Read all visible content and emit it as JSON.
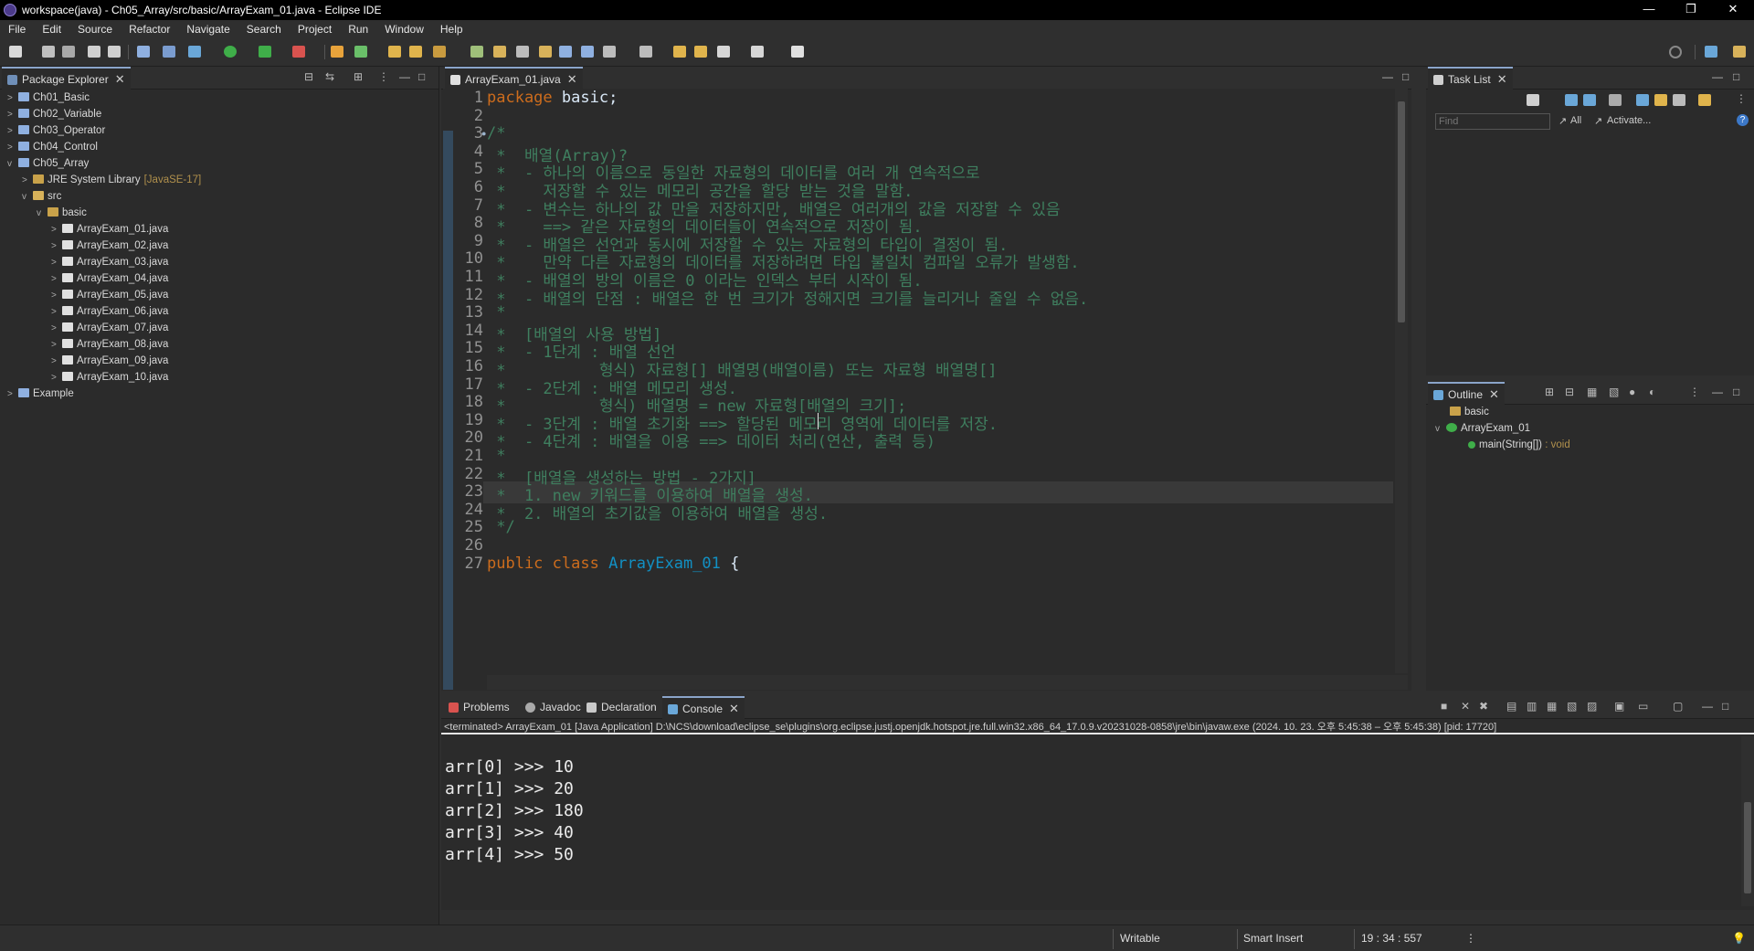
{
  "window": {
    "title": "workspace(java) - Ch05_Array/src/basic/ArrayExam_01.java - Eclipse IDE",
    "controls": [
      "—",
      "❐",
      "✕"
    ]
  },
  "menu": [
    "File",
    "Edit",
    "Source",
    "Refactor",
    "Navigate",
    "Search",
    "Project",
    "Run",
    "Window",
    "Help"
  ],
  "package_explorer": {
    "tab_label": "Package Explorer",
    "items": [
      {
        "label": "Ch01_Basic",
        "twisty": ">",
        "icon": "project-folder-icon"
      },
      {
        "label": "Ch02_Variable",
        "twisty": ">",
        "icon": "project-folder-icon"
      },
      {
        "label": "Ch03_Operator",
        "twisty": ">",
        "icon": "project-folder-icon"
      },
      {
        "label": "Ch04_Control",
        "twisty": ">",
        "icon": "project-folder-icon"
      },
      {
        "label": "Ch05_Array",
        "twisty": "v",
        "icon": "project-folder-icon"
      },
      {
        "label": "JRE System Library",
        "decoration": "[JavaSE-17]",
        "twisty": ">",
        "icon": "library-icon"
      },
      {
        "label": "src",
        "twisty": "v",
        "icon": "source-folder-icon"
      },
      {
        "label": "basic",
        "twisty": "v",
        "icon": "package-icon"
      },
      {
        "label": "ArrayExam_01.java",
        "twisty": ">",
        "icon": "java-file-icon"
      },
      {
        "label": "ArrayExam_02.java",
        "twisty": ">",
        "icon": "java-file-icon"
      },
      {
        "label": "ArrayExam_03.java",
        "twisty": ">",
        "icon": "java-file-icon"
      },
      {
        "label": "ArrayExam_04.java",
        "twisty": ">",
        "icon": "java-file-icon"
      },
      {
        "label": "ArrayExam_05.java",
        "twisty": ">",
        "icon": "java-file-icon"
      },
      {
        "label": "ArrayExam_06.java",
        "twisty": ">",
        "icon": "java-file-icon"
      },
      {
        "label": "ArrayExam_07.java",
        "twisty": ">",
        "icon": "java-file-icon"
      },
      {
        "label": "ArrayExam_08.java",
        "twisty": ">",
        "icon": "java-file-icon"
      },
      {
        "label": "ArrayExam_09.java",
        "twisty": ">",
        "icon": "java-file-icon"
      },
      {
        "label": "ArrayExam_10.java",
        "twisty": ">",
        "icon": "java-file-icon"
      },
      {
        "label": "Example",
        "twisty": ">",
        "icon": "project-folder-icon"
      }
    ]
  },
  "editor": {
    "tab_label": "ArrayExam_01.java",
    "lines": [
      {
        "n": "1",
        "text": "package basic;"
      },
      {
        "n": "2",
        "text": ""
      },
      {
        "n": "3",
        "text": "/*",
        "fold": "●"
      },
      {
        "n": "4",
        "text": " *  배열(Array)?"
      },
      {
        "n": "5",
        "text": " *  - 하나의 이름으로 동일한 자료형의 데이터를 여러 개 연속적으로"
      },
      {
        "n": "6",
        "text": " *    저장할 수 있는 메모리 공간을 할당 받는 것을 말함."
      },
      {
        "n": "7",
        "text": " *  - 변수는 하나의 값 만을 저장하지만, 배열은 여러개의 값을 저장할 수 있음"
      },
      {
        "n": "8",
        "text": " *    ==> 같은 자료형의 데이터들이 연속적으로 저장이 됨."
      },
      {
        "n": "9",
        "text": " *  - 배열은 선언과 동시에 저장할 수 있는 자료형의 타입이 결정이 됨."
      },
      {
        "n": "10",
        "text": " *    만약 다른 자료형의 데이터를 저장하려면 타입 불일치 컴파일 오류가 발생함."
      },
      {
        "n": "11",
        "text": " *  - 배열의 방의 이름은 0 이라는 인덱스 부터 시작이 됨."
      },
      {
        "n": "12",
        "text": " *  - 배열의 단점 : 배열은 한 번 크기가 정해지면 크기를 늘리거나 줄일 수 없음."
      },
      {
        "n": "13",
        "text": " *"
      },
      {
        "n": "14",
        "text": " *  [배열의 사용 방법]"
      },
      {
        "n": "15",
        "text": " *  - 1단계 : 배열 선언"
      },
      {
        "n": "16",
        "text": " *          형식) 자료형[] 배열명(배열이름) 또는 자료형 배열명[]"
      },
      {
        "n": "17",
        "text": " *  - 2단계 : 배열 메모리 생성."
      },
      {
        "n": "18",
        "text": " *          형식) 배열명 = new 자료형[배열의 크기];"
      },
      {
        "n": "19",
        "text": " *  - 3단계 : 배열 초기화 ==> 할당된 메모리 영역에 데이터를 저장."
      },
      {
        "n": "20",
        "text": " *  - 4단계 : 배열을 이용 ==> 데이터 처리(연산, 출력 등)"
      },
      {
        "n": "21",
        "text": " *"
      },
      {
        "n": "22",
        "text": " *  [배열을 생성하는 방법 - 2가지]"
      },
      {
        "n": "23",
        "text": " *  1. new 키워드를 이용하여 배열을 생성."
      },
      {
        "n": "24",
        "text": " *  2. 배열의 초기값을 이용하여 배열을 생성."
      },
      {
        "n": "25",
        "text": " */"
      },
      {
        "n": "26",
        "text": ""
      },
      {
        "n": "27",
        "kw": "public class ",
        "cls": "ArrayExam_01",
        "rest": " {"
      }
    ]
  },
  "task_list": {
    "tab_label": "Task List",
    "find_placeholder": "Find",
    "all_label": "All",
    "activate_label": "Activate..."
  },
  "outline": {
    "tab_label": "Outline",
    "items": [
      {
        "label": "basic",
        "icon": "package-icon"
      },
      {
        "label": "ArrayExam_01",
        "icon": "class-icon",
        "twisty": "v"
      },
      {
        "label": "main(String[])",
        "type": " : void",
        "icon": "method-icon"
      }
    ]
  },
  "bottom_tabs": {
    "problems": "Problems",
    "javadoc": "Javadoc",
    "declaration": "Declaration",
    "console": "Console"
  },
  "console": {
    "header": "<terminated> ArrayExam_01 [Java Application] D:\\NCS\\download\\eclipse_se\\plugins\\org.eclipse.justj.openjdk.hotspot.jre.full.win32.x86_64_17.0.9.v20231028-0858\\jre\\bin\\javaw.exe  (2024. 10. 23. 오후 5:45:38 – 오후 5:45:38) [pid: 17720]",
    "lines": [
      "arr[0] >>> 10",
      "arr[1] >>> 20",
      "arr[2] >>> 180",
      "arr[3] >>> 40",
      "arr[4] >>> 50"
    ]
  },
  "status": {
    "writable": "Writable",
    "insert_mode": "Smart Insert",
    "position": "19 : 34 : 557"
  }
}
